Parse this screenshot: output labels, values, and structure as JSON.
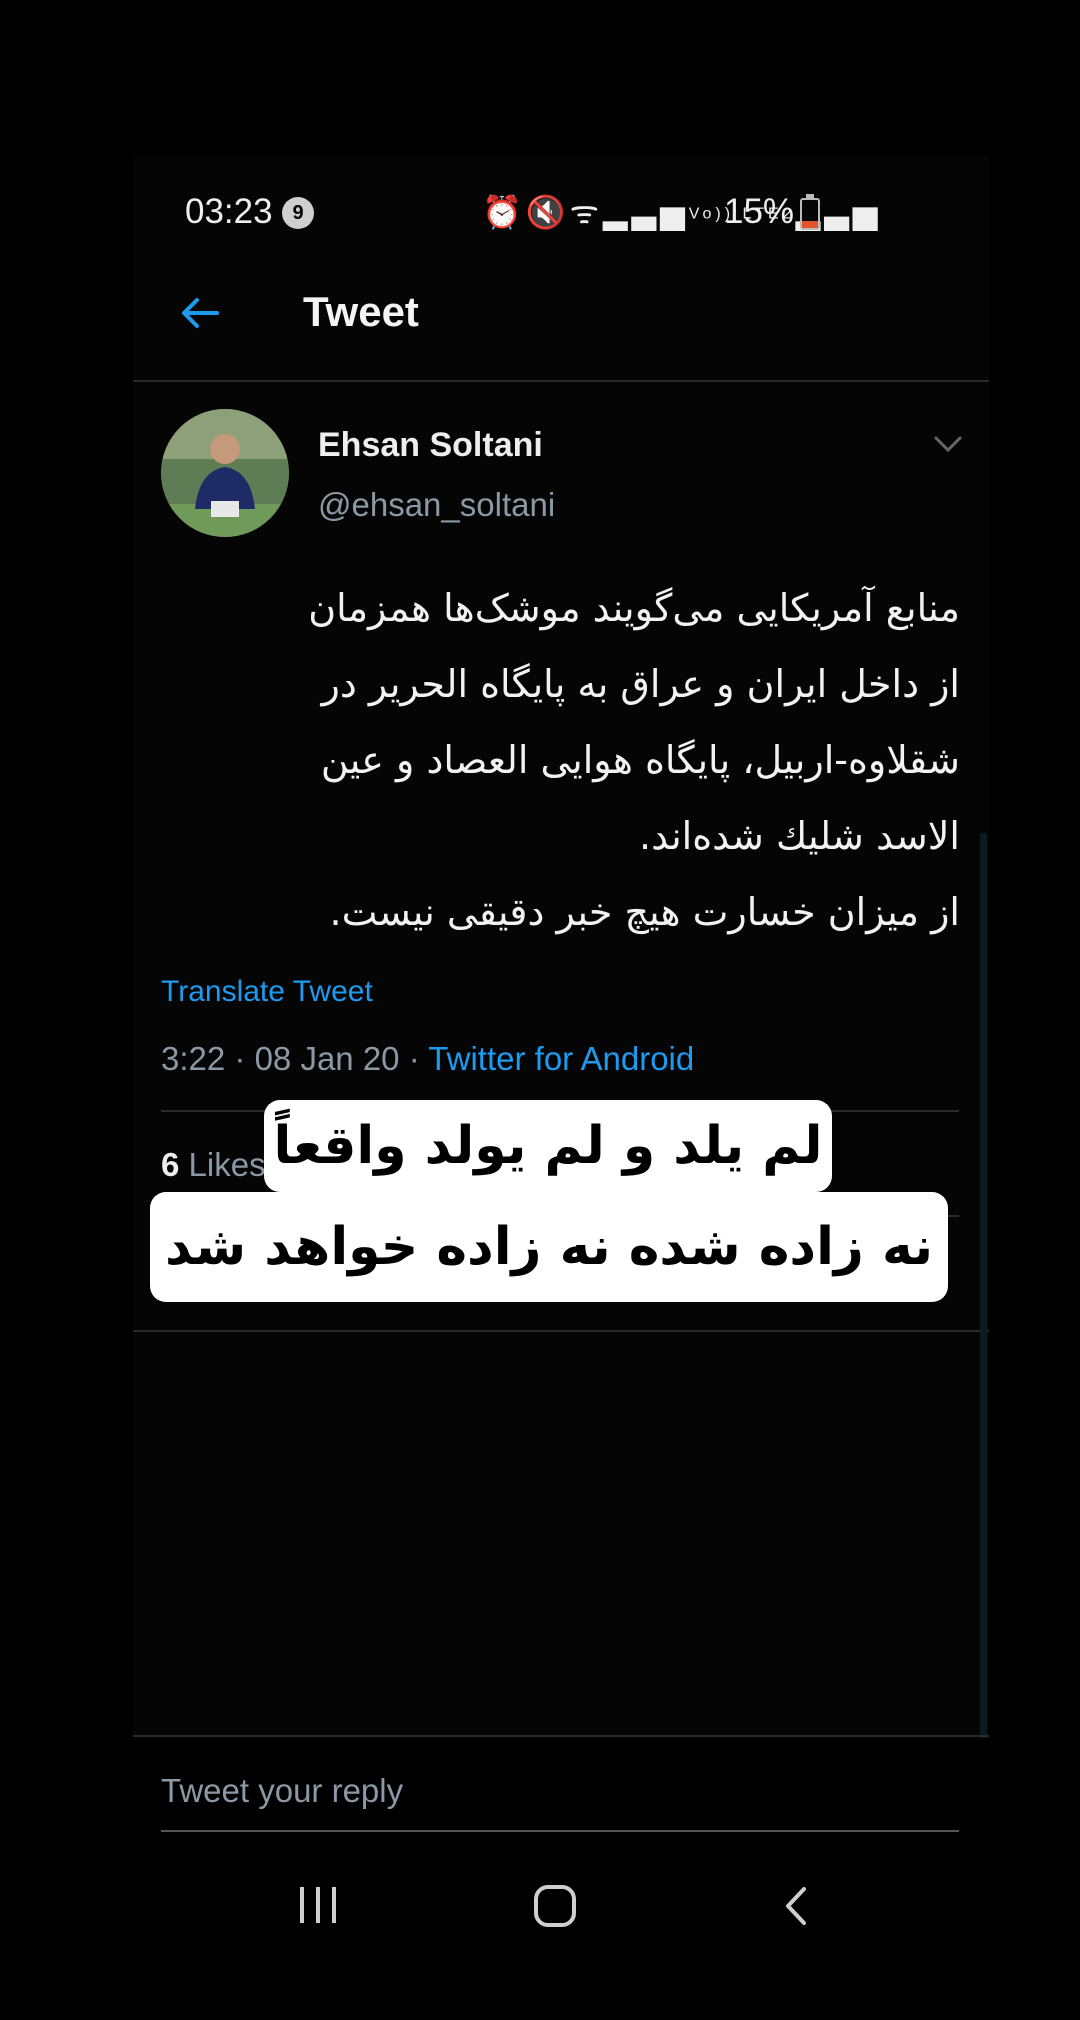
{
  "status_bar": {
    "time": "03:23",
    "notification_count": "9",
    "icons": [
      "alarm-icon",
      "mute-icon",
      "wifi-icon",
      "signal-icon",
      "volte-icon",
      "signal-icon"
    ],
    "volte_label": "Vo)) LTE2",
    "battery_percent": "15%"
  },
  "header": {
    "title": "Tweet",
    "back_icon": "arrow-left-icon"
  },
  "tweet": {
    "author_name": "Ehsan Soltani",
    "author_handle": "@ehsan_soltani",
    "text_lines": [
      "منابع آمریکایی می‌گویند موشک‌ها همزمان",
      "از داخل ایران و عراق به پایگاه الحریر در",
      "شقلاوه-اربیل، پایگاه هوایی العصاد و عین",
      "الاسد شلیك شده‌اند.",
      "از میزان خسارت هیچ خبر دقیقی نیست."
    ],
    "translate_label": "Translate Tweet",
    "time": "3:22",
    "date": "08 Jan 20",
    "separator": "·",
    "source": "Twitter for Android",
    "likes_count": "6",
    "likes_label": "Likes"
  },
  "caption": {
    "line1": "لم یلد و لم یولد واقعاً",
    "line2": "نه زاده شده نه زاده خواهد شد"
  },
  "reply": {
    "placeholder": "Tweet your reply"
  },
  "nav_bar": {
    "buttons": [
      "recent-apps-icon",
      "home-icon",
      "back-icon"
    ]
  },
  "colors": {
    "accent": "#1d9bf0",
    "background": "#000000",
    "secondary_text": "#8b98a5"
  }
}
